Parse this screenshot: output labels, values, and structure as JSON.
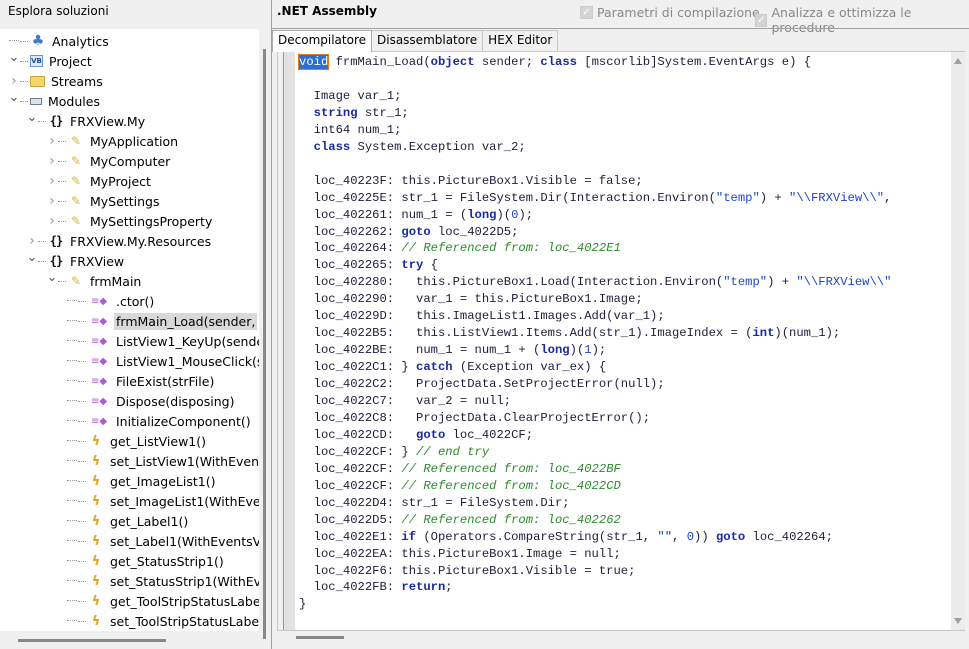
{
  "left_panel": {
    "title": "Esplora soluzioni",
    "tree": [
      {
        "label": "Analytics",
        "icon": "analytics-icon",
        "level": 0,
        "expander": "none"
      },
      {
        "label": "Project",
        "icon": "vb-project-icon",
        "level": 0,
        "expander": "expanded"
      },
      {
        "label": "Streams",
        "icon": "folder-icon",
        "level": 1,
        "expander": "collapsed"
      },
      {
        "label": "Modules",
        "icon": "module-icon",
        "level": 1,
        "expander": "expanded"
      },
      {
        "label": "FRXView.My",
        "icon": "namespace-icon",
        "level": 2,
        "expander": "expanded"
      },
      {
        "label": "MyApplication",
        "icon": "class-icon",
        "level": 3,
        "expander": "collapsed"
      },
      {
        "label": "MyComputer",
        "icon": "class-icon",
        "level": 3,
        "expander": "collapsed"
      },
      {
        "label": "MyProject",
        "icon": "class-icon",
        "level": 3,
        "expander": "collapsed"
      },
      {
        "label": "MySettings",
        "icon": "class-icon",
        "level": 3,
        "expander": "collapsed"
      },
      {
        "label": "MySettingsProperty",
        "icon": "class-icon",
        "level": 3,
        "expander": "collapsed"
      },
      {
        "label": "FRXView.My.Resources",
        "icon": "namespace-icon",
        "level": 2,
        "expander": "collapsed"
      },
      {
        "label": "FRXView",
        "icon": "namespace-icon",
        "level": 2,
        "expander": "expanded"
      },
      {
        "label": "frmMain",
        "icon": "class-icon",
        "level": 3,
        "expander": "expanded"
      },
      {
        "label": ".ctor()",
        "icon": "method-icon",
        "level": 4,
        "expander": "none"
      },
      {
        "label": "frmMain_Load(sender,",
        "icon": "method-icon",
        "level": 4,
        "expander": "none",
        "selected": true
      },
      {
        "label": "ListView1_KeyUp(sende",
        "icon": "method-icon",
        "level": 4,
        "expander": "none"
      },
      {
        "label": "ListView1_MouseClick(s",
        "icon": "method-icon",
        "level": 4,
        "expander": "none"
      },
      {
        "label": "FileExist(strFile)",
        "icon": "method-icon",
        "level": 4,
        "expander": "none"
      },
      {
        "label": "Dispose(disposing)",
        "icon": "method-icon",
        "level": 4,
        "expander": "none"
      },
      {
        "label": "InitializeComponent()",
        "icon": "method-icon",
        "level": 4,
        "expander": "none"
      },
      {
        "label": "get_ListView1()",
        "icon": "event-icon",
        "level": 4,
        "expander": "none"
      },
      {
        "label": "set_ListView1(WithEvent",
        "icon": "event-icon",
        "level": 4,
        "expander": "none"
      },
      {
        "label": "get_ImageList1()",
        "icon": "event-icon",
        "level": 4,
        "expander": "none"
      },
      {
        "label": "set_ImageList1(WithEve",
        "icon": "event-icon",
        "level": 4,
        "expander": "none"
      },
      {
        "label": "get_Label1()",
        "icon": "event-icon",
        "level": 4,
        "expander": "none"
      },
      {
        "label": "set_Label1(WithEventsV",
        "icon": "event-icon",
        "level": 4,
        "expander": "none"
      },
      {
        "label": "get_StatusStrip1()",
        "icon": "event-icon",
        "level": 4,
        "expander": "none"
      },
      {
        "label": "set_StatusStrip1(WithEv",
        "icon": "event-icon",
        "level": 4,
        "expander": "none"
      },
      {
        "label": "get_ToolStripStatusLabe",
        "icon": "event-icon",
        "level": 4,
        "expander": "none"
      },
      {
        "label": "set_ToolStripStatusLabe",
        "icon": "event-icon",
        "level": 4,
        "expander": "none"
      }
    ]
  },
  "right_panel": {
    "title": ".NET Assembly",
    "options": [
      {
        "label": "Parametri di compilazione",
        "checked": true,
        "enabled": false
      },
      {
        "label": "Analizza e ottimizza le procedure",
        "checked": true,
        "enabled": false
      }
    ],
    "tabs": [
      {
        "label": "Decompilatore",
        "active": true
      },
      {
        "label": "Disassemblatore",
        "active": false
      },
      {
        "label": "HEX Editor",
        "active": false
      }
    ],
    "colors": {
      "keyword": "#1a2aa0",
      "comment": "#2e8b2e",
      "string": "#1e46c8",
      "selection": "#2b6fd6"
    },
    "code_lines": [
      [
        {
          "t": "void",
          "c": "sel"
        },
        {
          "t": " frmMain_Load("
        },
        {
          "t": "object",
          "c": "kw"
        },
        {
          "t": " sender; "
        },
        {
          "t": "class",
          "c": "kw"
        },
        {
          "t": " [mscorlib]System.EventArgs e) {"
        }
      ],
      [],
      [
        {
          "t": "  Image var_1;"
        }
      ],
      [
        {
          "t": "  "
        },
        {
          "t": "string",
          "c": "kw"
        },
        {
          "t": " str_1;"
        }
      ],
      [
        {
          "t": "  int64 num_1;"
        }
      ],
      [
        {
          "t": "  "
        },
        {
          "t": "class",
          "c": "kw"
        },
        {
          "t": " System.Exception var_2;"
        }
      ],
      [],
      [
        {
          "t": "  loc_40223F: this.PictureBox1.Visible = false;"
        }
      ],
      [
        {
          "t": "  loc_40225E: str_1 = FileSystem.Dir(Interaction.Environ("
        },
        {
          "t": "\"temp\"",
          "c": "st"
        },
        {
          "t": ") + "
        },
        {
          "t": "\"\\\\FRXView\\\\\"",
          "c": "st"
        },
        {
          "t": ","
        }
      ],
      [
        {
          "t": "  loc_402261: num_1 = ("
        },
        {
          "t": "long",
          "c": "kw"
        },
        {
          "t": ")("
        },
        {
          "t": "0",
          "c": "nm"
        },
        {
          "t": ");"
        }
      ],
      [
        {
          "t": "  loc_402262: "
        },
        {
          "t": "goto",
          "c": "kw"
        },
        {
          "t": " loc_4022D5;"
        }
      ],
      [
        {
          "t": "  loc_402264: "
        },
        {
          "t": "// Referenced from: loc_4022E1",
          "c": "cm"
        }
      ],
      [
        {
          "t": "  loc_402265: "
        },
        {
          "t": "try",
          "c": "kw"
        },
        {
          "t": " {"
        }
      ],
      [
        {
          "t": "  loc_402280:   this.PictureBox1.Load(Interaction.Environ("
        },
        {
          "t": "\"temp\"",
          "c": "st"
        },
        {
          "t": ") + "
        },
        {
          "t": "\"\\\\FRXView\\\\\"",
          "c": "st"
        }
      ],
      [
        {
          "t": "  loc_402290:   var_1 = this.PictureBox1.Image;"
        }
      ],
      [
        {
          "t": "  loc_40229D:   this.ImageList1.Images.Add(var_1);"
        }
      ],
      [
        {
          "t": "  loc_4022B5:   this.ListView1.Items.Add(str_1).ImageIndex = ("
        },
        {
          "t": "int",
          "c": "kw"
        },
        {
          "t": ")(num_1);"
        }
      ],
      [
        {
          "t": "  loc_4022BE:   num_1 = num_1 + ("
        },
        {
          "t": "long",
          "c": "kw"
        },
        {
          "t": ")("
        },
        {
          "t": "1",
          "c": "nm"
        },
        {
          "t": ");"
        }
      ],
      [
        {
          "t": "  loc_4022C1: } "
        },
        {
          "t": "catch",
          "c": "kw"
        },
        {
          "t": " (Exception var_ex) {"
        }
      ],
      [
        {
          "t": "  loc_4022C2:   ProjectData.SetProjectError(null);"
        }
      ],
      [
        {
          "t": "  loc_4022C7:   var_2 = null;"
        }
      ],
      [
        {
          "t": "  loc_4022C8:   ProjectData.ClearProjectError();"
        }
      ],
      [
        {
          "t": "  loc_4022CD:   "
        },
        {
          "t": "goto",
          "c": "kw"
        },
        {
          "t": " loc_4022CF;"
        }
      ],
      [
        {
          "t": "  loc_4022CF: } "
        },
        {
          "t": "// end try",
          "c": "cm"
        }
      ],
      [
        {
          "t": "  loc_4022CF: "
        },
        {
          "t": "// Referenced from: loc_4022BF",
          "c": "cm"
        }
      ],
      [
        {
          "t": "  loc_4022CF: "
        },
        {
          "t": "// Referenced from: loc_4022CD",
          "c": "cm"
        }
      ],
      [
        {
          "t": "  loc_4022D4: str_1 = FileSystem.Dir;"
        }
      ],
      [
        {
          "t": "  loc_4022D5: "
        },
        {
          "t": "// Referenced from: loc_402262",
          "c": "cm"
        }
      ],
      [
        {
          "t": "  loc_4022E1: "
        },
        {
          "t": "if",
          "c": "kw"
        },
        {
          "t": " (Operators.CompareString(str_1, "
        },
        {
          "t": "\"\"",
          "c": "st"
        },
        {
          "t": ", "
        },
        {
          "t": "0",
          "c": "nm"
        },
        {
          "t": ")) "
        },
        {
          "t": "goto",
          "c": "kw"
        },
        {
          "t": " loc_402264;"
        }
      ],
      [
        {
          "t": "  loc_4022EA: this.PictureBox1.Image = null;"
        }
      ],
      [
        {
          "t": "  loc_4022F6: this.PictureBox1.Visible = true;"
        }
      ],
      [
        {
          "t": "  loc_4022FB: "
        },
        {
          "t": "return",
          "c": "kw"
        },
        {
          "t": ";"
        }
      ],
      [
        {
          "t": "}"
        }
      ]
    ]
  }
}
